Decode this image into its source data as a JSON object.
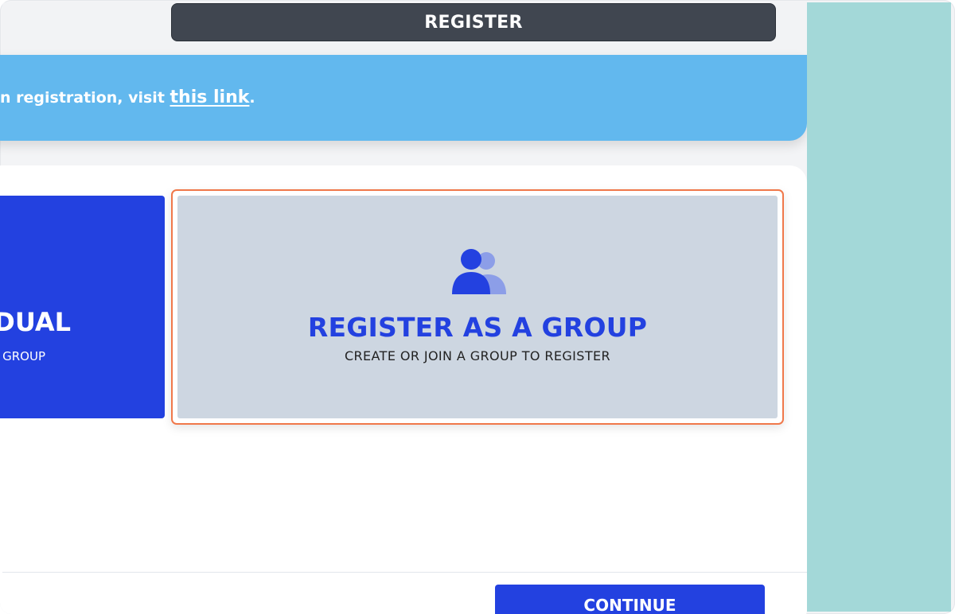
{
  "header": {
    "register_label": "REGISTER"
  },
  "banner": {
    "text": "n registration, visit ",
    "link_text": "this link",
    "suffix": "."
  },
  "options": {
    "individual": {
      "title": "DUAL",
      "subtitle": "GROUP"
    },
    "group": {
      "icon": "users-icon",
      "title": "REGISTER AS A GROUP",
      "subtitle": "CREATE OR JOIN A GROUP TO REGISTER"
    }
  },
  "footer": {
    "continue_label": "CONTINUE"
  },
  "colors": {
    "accent": "#2341e0",
    "banner": "#62b8ee",
    "header": "#404650",
    "selected_border": "#f0784a",
    "side_panel": "#a3d8d8"
  }
}
